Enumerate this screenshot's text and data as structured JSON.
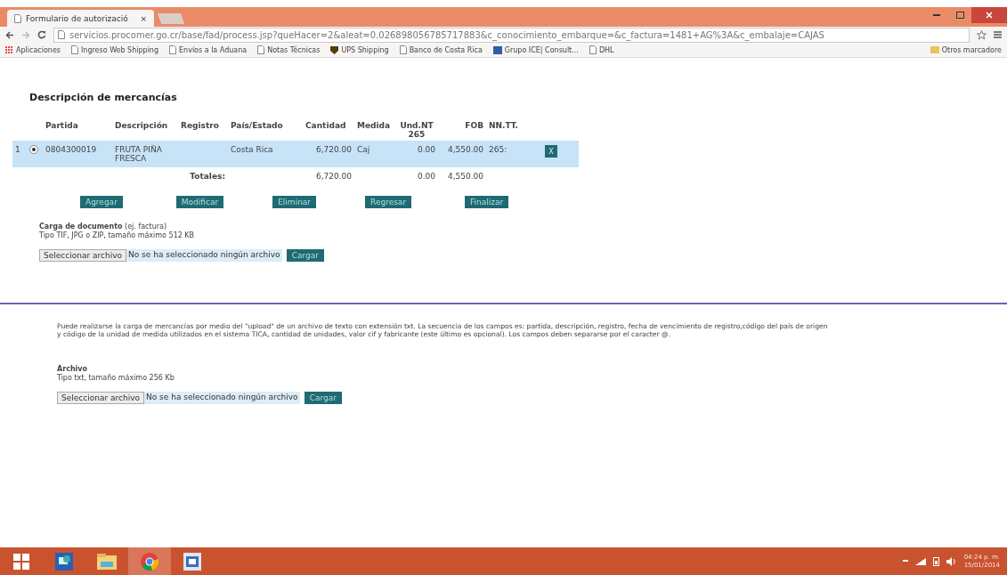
{
  "browser": {
    "tab": {
      "title": "Formulario de autorizació",
      "close": "×"
    },
    "url": "servicios.procomer.go.cr/base/fad/process.jsp?queHacer=2&aleat=0.026898056785717883&c_conocimiento_embarque=&c_factura=1481+AG%3A&c_embalaje=CAJAS",
    "bookmarks": [
      {
        "label": "Aplicaciones",
        "kind": "apps"
      },
      {
        "label": "Ingreso Web Shipping",
        "kind": "page"
      },
      {
        "label": "Envíos a la Aduana",
        "kind": "page"
      },
      {
        "label": "Notas Técnicas",
        "kind": "page"
      },
      {
        "label": "UPS Shipping",
        "kind": "shield"
      },
      {
        "label": "Banco de Costa Rica",
        "kind": "page"
      },
      {
        "label": "Grupo ICE| Consult...",
        "kind": "tile"
      },
      {
        "label": "DHL",
        "kind": "page"
      }
    ],
    "other_bookmarks": "Otros marcadore"
  },
  "page": {
    "heading": "Descripción de mercancías",
    "table": {
      "columns": [
        "Partida",
        "Descripción",
        "Registro",
        "País/Estado",
        "Cantidad",
        "Medida",
        "Und.NT 265",
        "FOB",
        "NN.TT."
      ],
      "rows": [
        {
          "index": "1",
          "selected": true,
          "cells": [
            "0804300019",
            "FRUTA PIÑA FRESCA",
            null,
            "Costa Rica",
            "6,720.00",
            "Caj",
            "0.00",
            "4,550.00",
            "265:"
          ],
          "delete": "X"
        }
      ],
      "totals": {
        "label": "Totales:",
        "cantidad": "6,720.00",
        "und_nt": "0.00",
        "fob": "4,550.00"
      }
    },
    "actions": [
      "Agregar",
      "Modificar",
      "Eliminar",
      "Regresar",
      "Finalizar"
    ],
    "document_upload": {
      "title": "Carga de documento",
      "hint": "(ej. factura)",
      "types": "Tipo TIF, JPG o ZIP, tamaño máximo 512 KB",
      "choose": "Seleccionar archivo",
      "status": "No se ha seleccionado ningún archivo",
      "upload": "Cargar"
    },
    "text_upload": {
      "description": "Puede realizarse la carga de mercancías por medio del \"upload\" de un archivo de texto con extensión txt. La secuencia de los campos es: partida, descripción, registro, fecha de vencimiento de registro,código del país de origen y código de la unidad de medida utilizados en el sistema TICA, cantidad de unidades, valor cif y fabricante (este último es opcional). Los campos deben separarse por el caracter @.",
      "title": "Archivo",
      "types": "Tipo txt, tamaño máximo 256 Kb",
      "choose": "Seleccionar archivo",
      "status": "No se ha seleccionado ningún archivo",
      "upload": "Cargar"
    }
  },
  "taskbar": {
    "time": "04:24 p. m.",
    "date": "15/01/2014"
  }
}
